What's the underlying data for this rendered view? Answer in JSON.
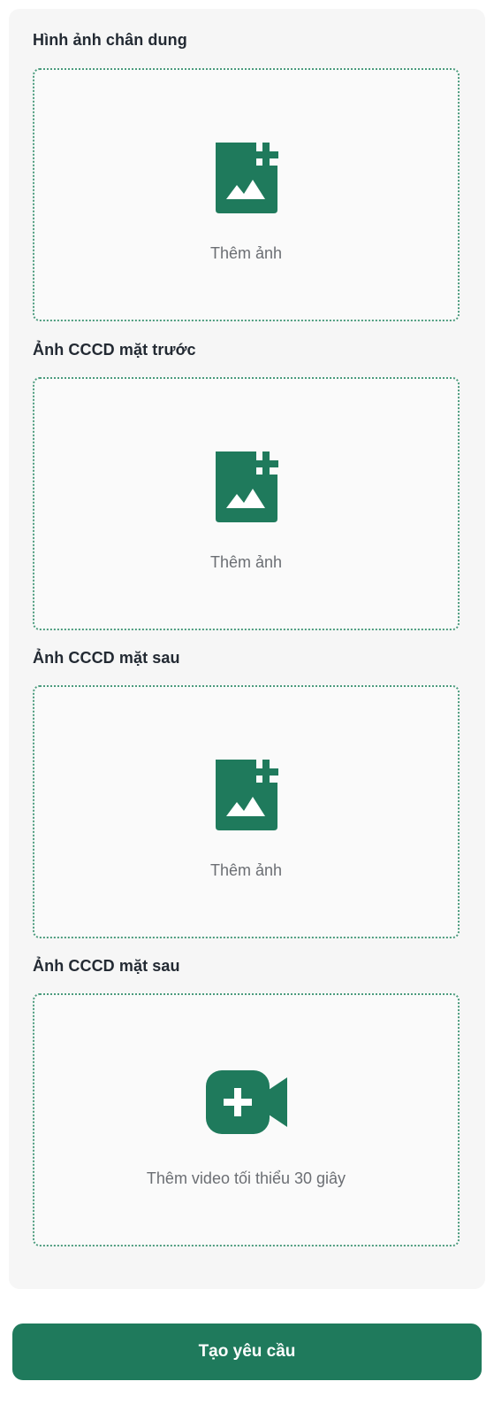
{
  "sections": [
    {
      "title": "Hình ảnh chân dung",
      "action_label": "Thêm ảnh",
      "icon": "add-image-icon"
    },
    {
      "title": "Ảnh CCCD mặt trước",
      "action_label": "Thêm ảnh",
      "icon": "add-image-icon"
    },
    {
      "title": "Ảnh CCCD mặt sau",
      "action_label": "Thêm ảnh",
      "icon": "add-image-icon"
    },
    {
      "title": "Ảnh CCCD mặt sau",
      "action_label": "Thêm video tối thiểu 30 giây",
      "icon": "add-video-icon"
    }
  ],
  "submit": {
    "label": "Tạo yêu cầu"
  },
  "colors": {
    "accent": "#1f7a5c",
    "card_background": "#f6f6f6",
    "dropzone_border": "#4b9b7d",
    "muted_text": "#6b6e73"
  }
}
